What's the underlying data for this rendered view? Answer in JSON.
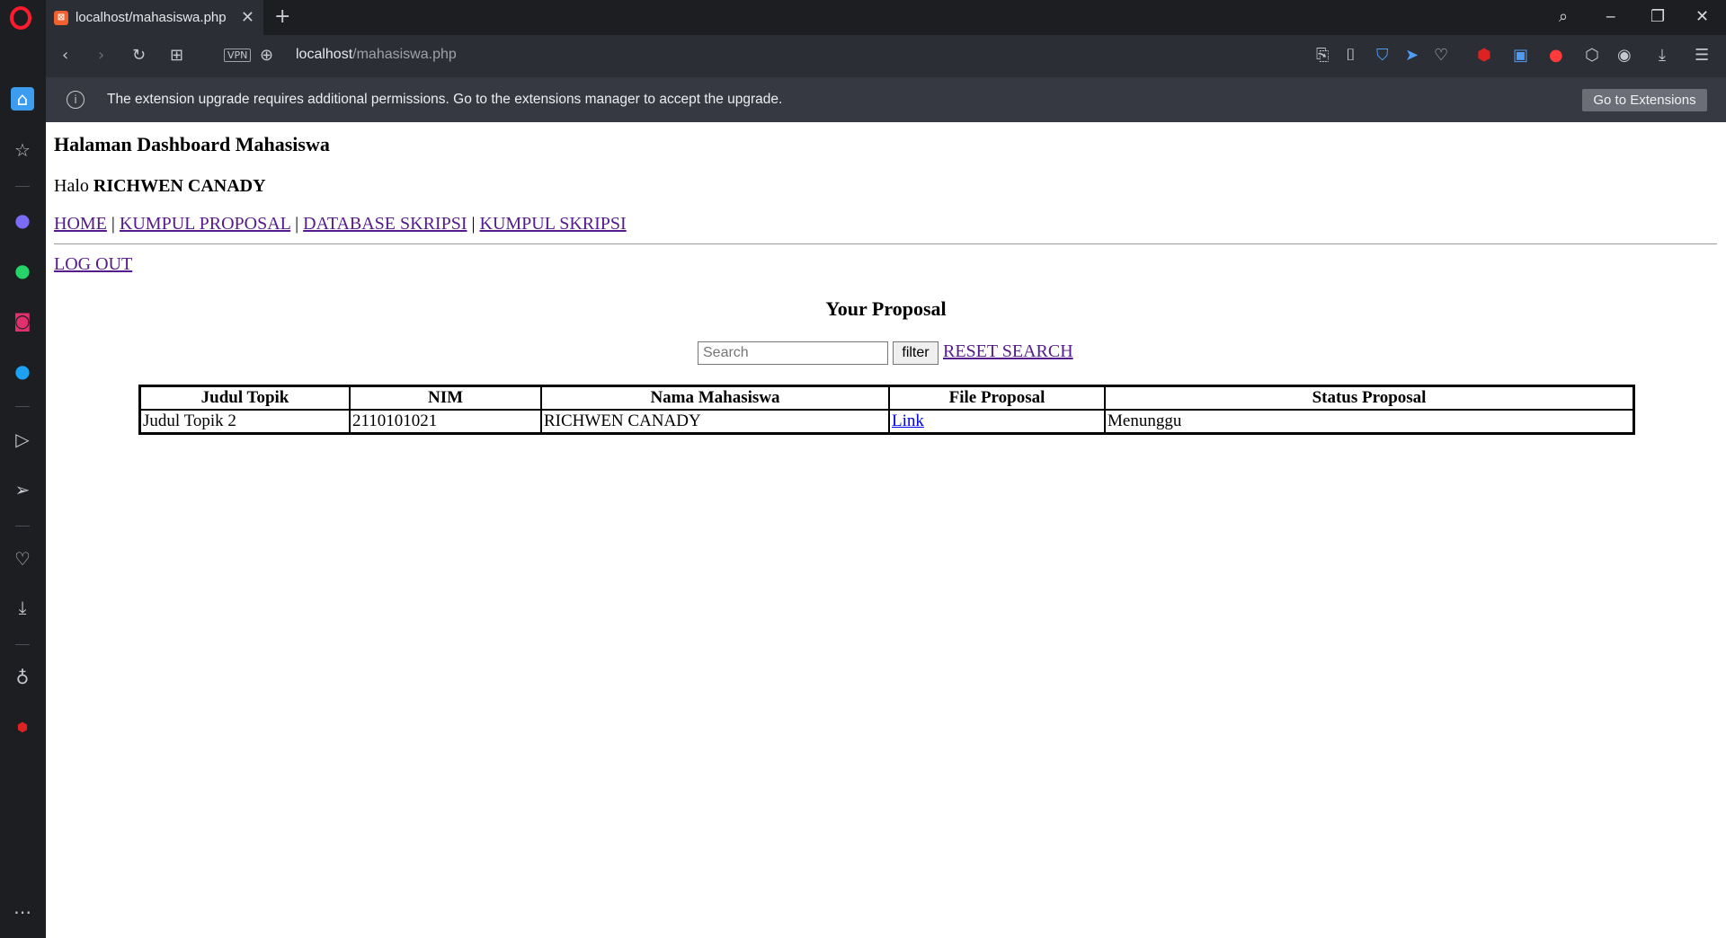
{
  "browser": {
    "tab_title": "localhost/mahasiswa.php",
    "url_host": "localhost",
    "url_path": "/mahasiswa.php",
    "vpn_label": "VPN",
    "notification": "The extension upgrade requires additional permissions. Go to the extensions manager to accept the upgrade.",
    "notification_button": "Go to Extensions"
  },
  "page": {
    "heading": "Halaman Dashboard Mahasiswa",
    "greeting_prefix": "Halo",
    "user_name": "RICHWEN CANADY",
    "nav": [
      "HOME",
      "KUMPUL PROPOSAL",
      "DATABASE SKRIPSI",
      "KUMPUL SKRIPSI"
    ],
    "nav_separator": "|",
    "logout": "LOG OUT",
    "section_title": "Your Proposal",
    "search_placeholder": "Search",
    "filter_button": "filter",
    "reset_link": "RESET SEARCH",
    "table": {
      "headers": [
        "Judul Topik",
        "NIM",
        "Nama Mahasiswa",
        "File Proposal",
        "Status Proposal"
      ],
      "rows": [
        [
          "Judul Topik 2",
          "2110101021",
          "RICHWEN CANADY",
          "Link",
          "Menunggu"
        ]
      ]
    }
  }
}
